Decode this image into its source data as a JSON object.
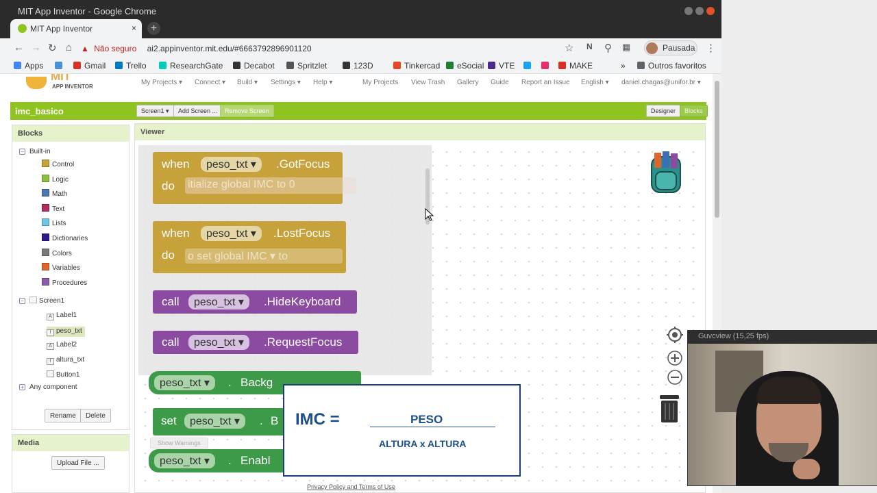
{
  "window": {
    "title": "MIT App Inventor - Google Chrome"
  },
  "tab": {
    "label": "MIT App Inventor",
    "close": "×",
    "new_tab": "+"
  },
  "address": {
    "security_label": "Não seguro",
    "url": "ai2.appinventor.mit.edu/#6663792896901120"
  },
  "profile": {
    "label": "Pausada"
  },
  "bookmarks": {
    "items": [
      {
        "label": "Apps",
        "color": "#4285f4"
      },
      {
        "label": "",
        "color": "#4a90d9"
      },
      {
        "label": "Gmail",
        "color": "#d93025"
      },
      {
        "label": "Trello",
        "color": "#0079bf"
      },
      {
        "label": "ResearchGate",
        "color": "#00ccbb"
      },
      {
        "label": "Decabot",
        "color": "#333333"
      },
      {
        "label": "Spritzlet",
        "color": "#555555"
      },
      {
        "label": "123D",
        "color": "#333333"
      },
      {
        "label": "Tinkercad",
        "color": "#e8462b"
      },
      {
        "label": "eSocial",
        "color": "#1e7e34"
      },
      {
        "label": "VTE",
        "color": "#4a2b8c"
      },
      {
        "label": "",
        "color": "#1da1f2"
      },
      {
        "label": "",
        "color": "#e1306c"
      },
      {
        "label": "MAKE",
        "color": "#d93025"
      }
    ],
    "more": "»",
    "other": "Outros favoritos"
  },
  "ai_top": {
    "logo_mit": "MIT",
    "logo_sub": "APP INVENTOR",
    "menu_left": [
      "My Projects ▾",
      "Connect ▾",
      "Build ▾",
      "Settings ▾",
      "Help ▾"
    ],
    "menu_right": [
      "My Projects",
      "View Trash",
      "Gallery",
      "Guide",
      "Report an Issue",
      "English ▾",
      "daniel.chagas@unifor.br ▾"
    ]
  },
  "toolbar": {
    "project_name": "imc_basico",
    "screen_select": "Screen1 ▾",
    "add_screen": "Add Screen ...",
    "remove_screen": "Remove Screen",
    "designer": "Designer",
    "blocks": "Blocks"
  },
  "blocks_panel": {
    "title": "Blocks",
    "builtin_label": "Built-in",
    "builtin": [
      {
        "label": "Control",
        "color": "#c7a13a"
      },
      {
        "label": "Logic",
        "color": "#8cbf3f"
      },
      {
        "label": "Math",
        "color": "#4a78b5"
      },
      {
        "label": "Text",
        "color": "#b32d5e"
      },
      {
        "label": "Lists",
        "color": "#6ec6e6"
      },
      {
        "label": "Dictionaries",
        "color": "#2d1a8c"
      },
      {
        "label": "Colors",
        "color": "#7a7a7a"
      },
      {
        "label": "Variables",
        "color": "#e0652c"
      },
      {
        "label": "Procedures",
        "color": "#8a5ba8"
      }
    ],
    "screen_label": "Screen1",
    "components": [
      {
        "label": "Label1",
        "icon": "A"
      },
      {
        "label": "peso_txt",
        "icon": "I",
        "selected": true
      },
      {
        "label": "Label2",
        "icon": "A"
      },
      {
        "label": "altura_txt",
        "icon": "I"
      },
      {
        "label": "Button1",
        "icon": ""
      }
    ],
    "any_component": "Any component",
    "rename": "Rename",
    "delete": "Delete"
  },
  "media_panel": {
    "title": "Media",
    "upload": "Upload File ..."
  },
  "viewer": {
    "title": "Viewer",
    "show_warnings": "Show Warnings"
  },
  "flyout_blocks": {
    "gotfocus": {
      "when": "when",
      "component": "peso_txt ▾",
      "event": ".GotFocus",
      "do": "do",
      "ghost": "itialize global  IMC  to      0"
    },
    "lostfocus": {
      "when": "when",
      "component": "peso_txt ▾",
      "event": ".LostFocus",
      "do": "do",
      "ghost": "o    set  global IMC ▾  to"
    },
    "hidekeyboard": {
      "call": "call",
      "component": "peso_txt ▾",
      "method": ".HideKeyboard"
    },
    "requestfocus": {
      "call": "call",
      "component": "peso_txt ▾",
      "method": ".RequestFocus"
    },
    "background": {
      "component": "peso_txt ▾",
      "dot": ".",
      "prop": "Backg"
    },
    "set_block": {
      "set": "set",
      "component": "peso_txt ▾",
      "dot": ".",
      "prop": "B"
    },
    "enable": {
      "component": "peso_txt ▾",
      "dot": ".",
      "prop": "Enabl"
    }
  },
  "overlay_formula": {
    "lhs": "IMC =",
    "numerator": "PESO",
    "denominator": "ALTURA x ALTURA"
  },
  "guvcview": {
    "title": "Guvcview (15,25 fps)"
  },
  "footer": {
    "link": "Privacy Policy and Terms of Use"
  },
  "colors": {
    "ai_green": "#8fc31f",
    "event_gold": "#c7a13a",
    "method_purple": "#8a4ba0",
    "prop_green": "#3c9a48"
  }
}
